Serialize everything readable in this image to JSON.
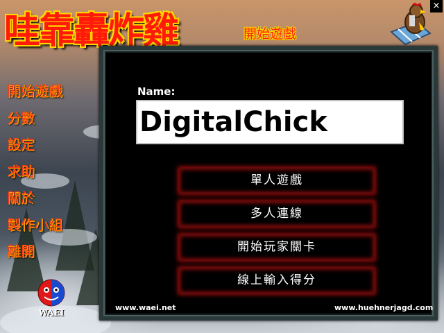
{
  "title": {
    "main": "哇靠轟炸雞",
    "sub": "開始遊戲"
  },
  "window": {
    "close_label": "×"
  },
  "menu": {
    "items": [
      {
        "label": "開始遊戲"
      },
      {
        "label": "分數"
      },
      {
        "label": "設定"
      },
      {
        "label": "求助"
      },
      {
        "label": "關於"
      },
      {
        "label": "製作小組"
      },
      {
        "label": "離開"
      }
    ]
  },
  "logo": {
    "text": "WAEI"
  },
  "name_form": {
    "label": "Name:",
    "value": "DigitalChick"
  },
  "buttons": {
    "single_player": "單人遊戲",
    "multiplayer": "多人連線",
    "start_player_level": "開始玩家關卡",
    "online_score": "線上輸入得分"
  },
  "footer": {
    "left_link": "www.waei.net",
    "right_link": "www.huehnerjagd.com"
  },
  "colors": {
    "title_red": "#ff1a0a",
    "title_outline": "#ffd800",
    "button_glow": "#9a0c0c",
    "panel_bg": "#000000"
  }
}
